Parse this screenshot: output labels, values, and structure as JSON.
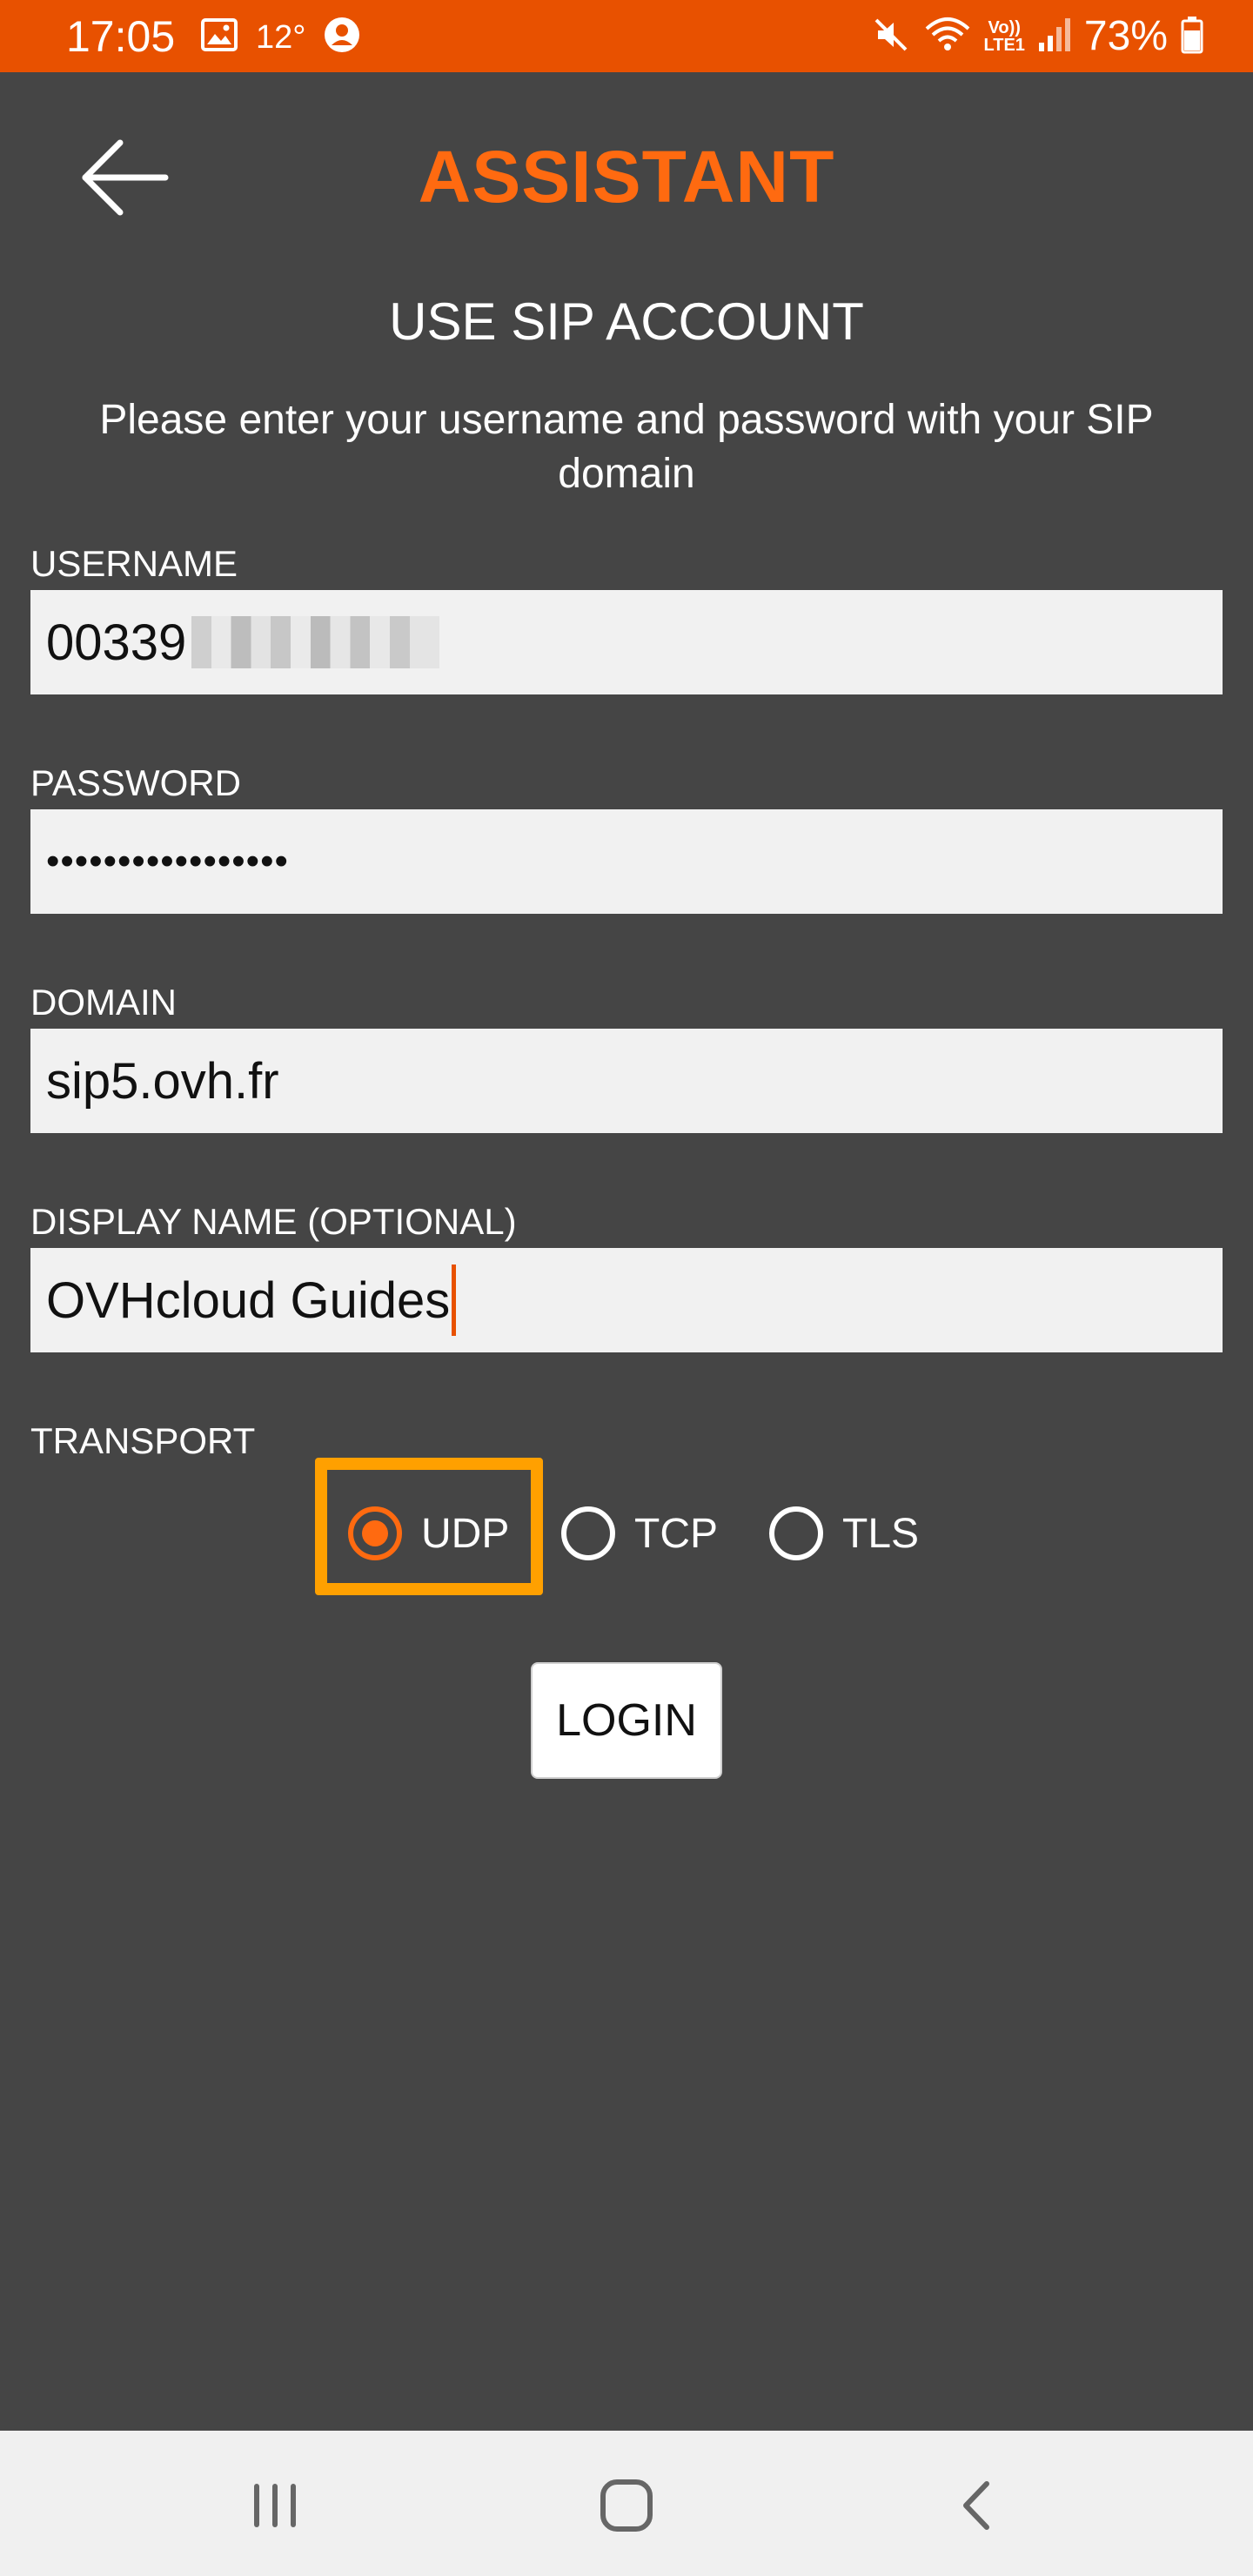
{
  "status_bar": {
    "time": "17:05",
    "temperature": "12°",
    "battery_percent": "73%",
    "icons": [
      "gallery-icon",
      "account-icon",
      "mute-icon",
      "wifi-icon",
      "volte-lte-icon",
      "signal-icon",
      "battery-icon"
    ],
    "volte_line1": "Vo))",
    "volte_line2": "LTE1"
  },
  "header": {
    "title": "ASSISTANT",
    "back_icon": "arrow-left-icon"
  },
  "form": {
    "section_title": "USE SIP ACCOUNT",
    "instructions": "Please enter your username and password with your SIP domain",
    "username_label": "USERNAME",
    "username_value": "00339",
    "password_label": "PASSWORD",
    "password_value": "•••••••••••••••••",
    "domain_label": "DOMAIN",
    "domain_value": "sip5.ovh.fr",
    "display_name_label": "DISPLAY NAME (OPTIONAL)",
    "display_name_value": "OVHcloud Guides",
    "transport_label": "TRANSPORT",
    "transport_options": [
      "UDP",
      "TCP",
      "TLS"
    ],
    "transport_selected": "UDP",
    "login_label": "LOGIN"
  },
  "colors": {
    "accent": "#e85100",
    "title": "#ff6a10",
    "highlight": "#ffa000",
    "background": "#454545",
    "field": "#f1f1f1"
  },
  "nav_bar": {
    "icons": [
      "recent-apps-icon",
      "home-icon",
      "back-icon"
    ]
  }
}
